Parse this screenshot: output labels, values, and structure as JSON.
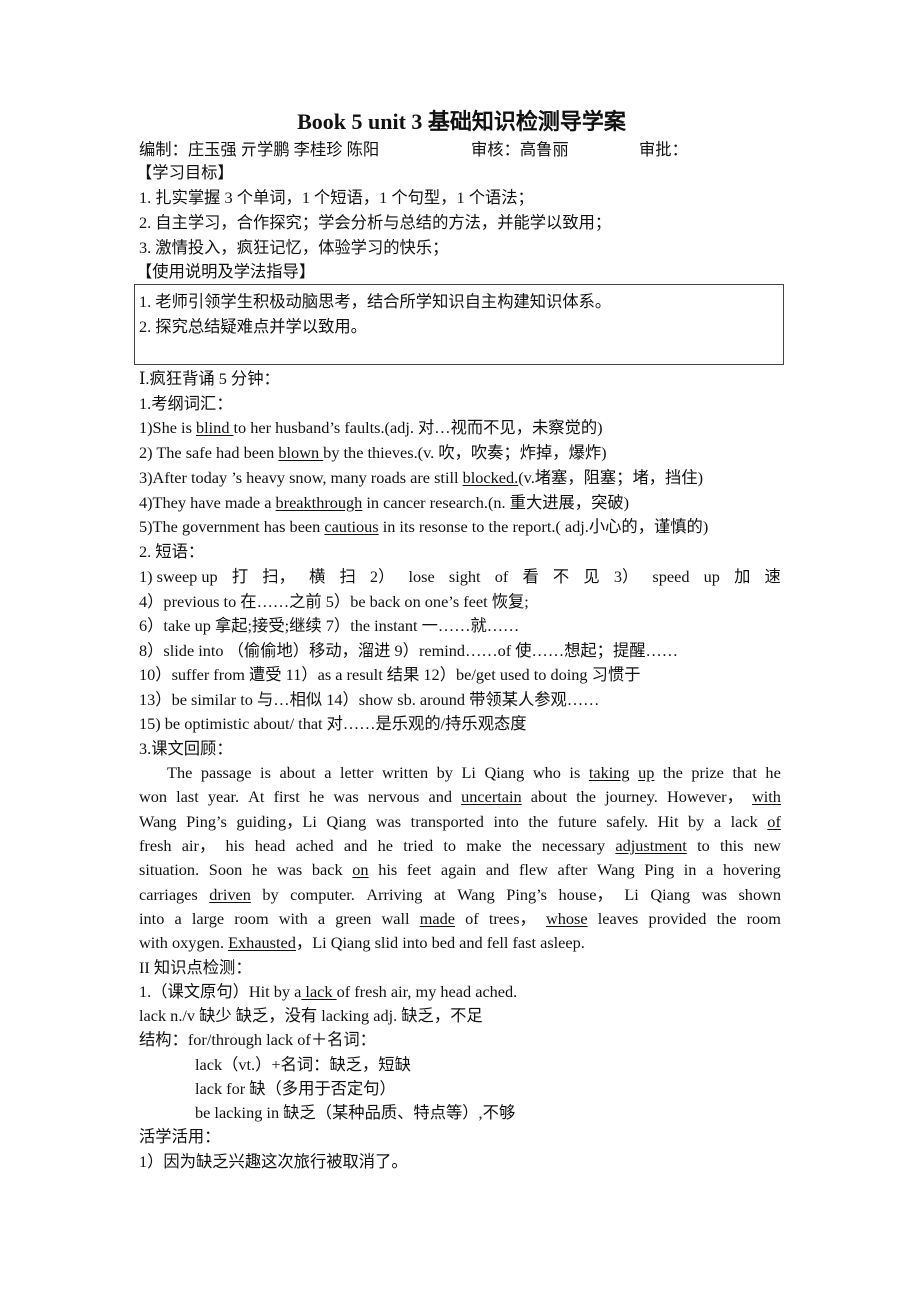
{
  "title": "Book 5 unit 3  基础知识检测导学案",
  "authors_line": {
    "editors": "编制：庄玉强  亓学鹏  李桂珍  陈阳",
    "reviewer": "审核：高鲁丽",
    "approver": "审批："
  },
  "objectives": {
    "heading": "【学习目标】",
    "items": [
      "1. 扎实掌握 3 个单词，1 个短语，1 个句型，1 个语法；",
      "2. 自主学习，合作探究；学会分析与总结的方法，并能学以致用；",
      "3. 激情投入，疯狂记忆，体验学习的快乐；"
    ]
  },
  "guidance": {
    "heading": "【使用说明及学法指导】",
    "items": [
      "1. 老师引领学生积极动脑思考，结合所学知识自主构建知识体系。",
      "2. 探究总结疑难点并学以致用。"
    ]
  },
  "section1": {
    "heading": "Ⅰ.疯狂背诵 5 分钟：",
    "vocab_heading": "1.考纲词汇：",
    "vocab": [
      {
        "pre": "1)She is ",
        "word": "blind ",
        "post": "to her husband’s faults.(adj.  对…视而不见，未察觉的)"
      },
      {
        "pre": "2) The safe had been ",
        "word": "blown ",
        "post": "by the thieves.(v.  吹，吹奏；炸掉，爆炸)"
      },
      {
        "pre": "3)After today ’s heavy snow, many roads are still ",
        "word": "blocked.",
        "post": "(v.堵塞，阻塞；堵，挡住)"
      },
      {
        "pre": "4)They have made a ",
        "word": "breakthrough",
        "post": " in cancer research.(n.  重大进展，突破)"
      },
      {
        "pre": "5)The government has been ",
        "word": "cautious",
        "post": " in its resonse to the report.( adj.小心的，谨慎的)"
      }
    ],
    "phrases_heading": "2. 短语：",
    "phrases_lines": [
      [
        "1) sweep up",
        "打",
        "扫，",
        "横",
        "扫",
        "2）",
        "lose",
        "sight",
        "of",
        "看",
        "不",
        "见",
        "3）",
        "speed",
        "up",
        "加",
        "速"
      ],
      "4）previous to  在……之前    5）be back on one’s feet 恢复;",
      "6）take up  拿起;接受;继续      7）the instant        一……就……",
      "8）slide into   （偷偷地）移动，溜进  9）remind……of    使……想起；提醒……",
      "10）suffer from     遭受     11）as a result 结果     12）be/get used to doing 习惯于",
      "13）be similar to 与…相似  14）show sb. around  带领某人参观……",
      "15) be optimistic about/ that  对……是乐观的/持乐观态度"
    ],
    "review_heading": "3.课文回顾：",
    "passage_lines": [
      [
        {
          "t": "The passage is about a letter written by Li Qiang who is "
        },
        {
          "t": "taking up",
          "u": true
        },
        {
          "t": " the prize that he"
        }
      ],
      [
        {
          "t": "won last year. At first he was nervous and "
        },
        {
          "t": "uncertain ",
          "u": true
        },
        {
          "t": "about the journey. However，"
        },
        {
          "t": "with",
          "u": true
        }
      ],
      [
        {
          "t": "Wang Ping’s guiding，Li Qiang was transported into the future safely. Hit by a lack "
        },
        {
          "t": "of",
          "u": true
        }
      ],
      [
        {
          "t": "fresh air，  his head ached and he tried to make the necessary   "
        },
        {
          "t": "adjustment ",
          "u": true
        },
        {
          "t": "to this new"
        }
      ],
      [
        {
          "t": "situation. Soon he was back "
        },
        {
          "t": "on",
          "u": true
        },
        {
          "t": " his feet again and flew after Wang Ping in a hovering"
        }
      ],
      [
        {
          "t": "carriages "
        },
        {
          "t": "driven",
          "u": true
        },
        {
          "t": " by computer. Arriving at Wang Ping’s house，  Li Qiang was shown"
        }
      ],
      [
        {
          "t": "into a large room with a green wall "
        },
        {
          "t": "made",
          "u": true
        },
        {
          "t": " of trees，  "
        },
        {
          "t": "whose ",
          "u": true
        },
        {
          "t": "leaves provided the room"
        }
      ],
      [
        {
          "t": "with oxygen. "
        },
        {
          "t": "Exhausted",
          "u": true
        },
        {
          "t": "，Li Qiang slid into bed and fell fast asleep."
        }
      ]
    ]
  },
  "section2": {
    "heading": "II  知识点检测：",
    "item1": {
      "pre": "1.（课文原句）Hit by a",
      "word": " lack ",
      "post": "of fresh air, my head ached."
    },
    "lines": [
      "lack n./v  缺少  缺乏，没有     lacking adj.  缺乏，不足",
      "结构：for/through lack of＋名词："
    ],
    "structures": [
      "lack（vt.）+名词：缺乏，短缺",
      "lack for  缺（多用于否定句）",
      "be lacking in 缺乏（某种品质、特点等）,不够"
    ],
    "practice_heading": "活学活用：",
    "practice": [
      "1）因为缺乏兴趣这次旅行被取消了。"
    ]
  }
}
